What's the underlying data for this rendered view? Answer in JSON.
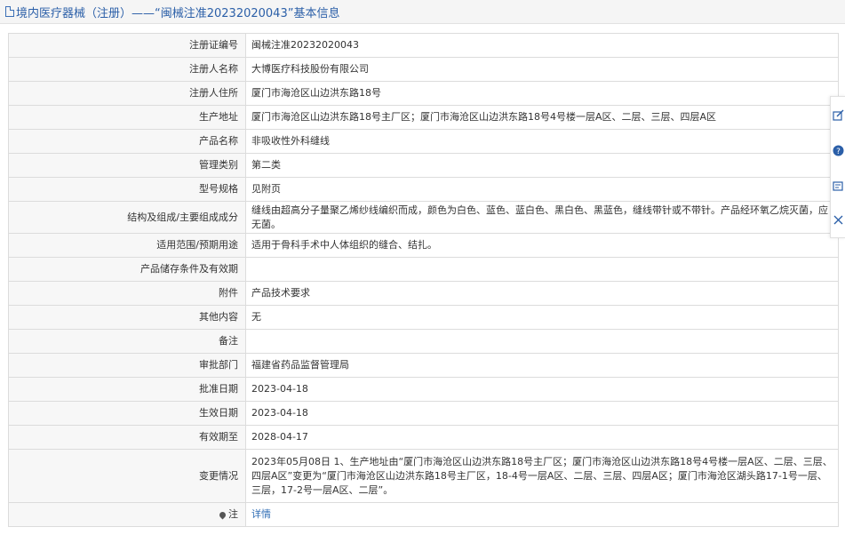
{
  "header": {
    "title": "境内医疗器械（注册）——“闽械注准20232020043”基本信息"
  },
  "rows": [
    {
      "label": "注册证编号",
      "value": "闽械注准20232020043"
    },
    {
      "label": "注册人名称",
      "value": "大博医疗科技股份有限公司"
    },
    {
      "label": "注册人住所",
      "value": "厦门市海沧区山边洪东路18号"
    },
    {
      "label": "生产地址",
      "value": "厦门市海沧区山边洪东路18号主厂区；厦门市海沧区山边洪东路18号4号楼一层A区、二层、三层、四层A区"
    },
    {
      "label": "产品名称",
      "value": "非吸收性外科缝线"
    },
    {
      "label": "管理类别",
      "value": "第二类"
    },
    {
      "label": "型号规格",
      "value": "见附页"
    },
    {
      "label": "结构及组成/主要组成成分",
      "value": "缝线由超高分子量聚乙烯纱线编织而成，颜色为白色、蓝色、蓝白色、黑白色、黑蓝色，缝线带针或不带针。产品经环氧乙烷灭菌，应无菌。"
    },
    {
      "label": "适用范围/预期用途",
      "value": "适用于骨科手术中人体组织的缝合、结扎。"
    },
    {
      "label": "产品储存条件及有效期",
      "value": ""
    },
    {
      "label": "附件",
      "value": "产品技术要求"
    },
    {
      "label": "其他内容",
      "value": "无"
    },
    {
      "label": "备注",
      "value": ""
    },
    {
      "label": "审批部门",
      "value": "福建省药品监督管理局"
    },
    {
      "label": "批准日期",
      "value": "2023-04-18"
    },
    {
      "label": "生效日期",
      "value": "2023-04-18"
    },
    {
      "label": "有效期至",
      "value": "2028-04-17"
    },
    {
      "label": "变更情况",
      "value": "2023年05月08日 1、生产地址由“厦门市海沧区山边洪东路18号主厂区；厦门市海沧区山边洪东路18号4号楼一层A区、二层、三层、四层A区”变更为“厦门市海沧区山边洪东路18号主厂区，18-4号一层A区、二层、三层、四层A区；厦门市海沧区湖头路17-1号一层、三层，17-2号一层A区、二层”。"
    }
  ],
  "note_row": {
    "label": "注",
    "link": "详情"
  },
  "side_tools": [
    "edit-icon",
    "help-icon",
    "feedback-icon",
    "close-icon"
  ]
}
